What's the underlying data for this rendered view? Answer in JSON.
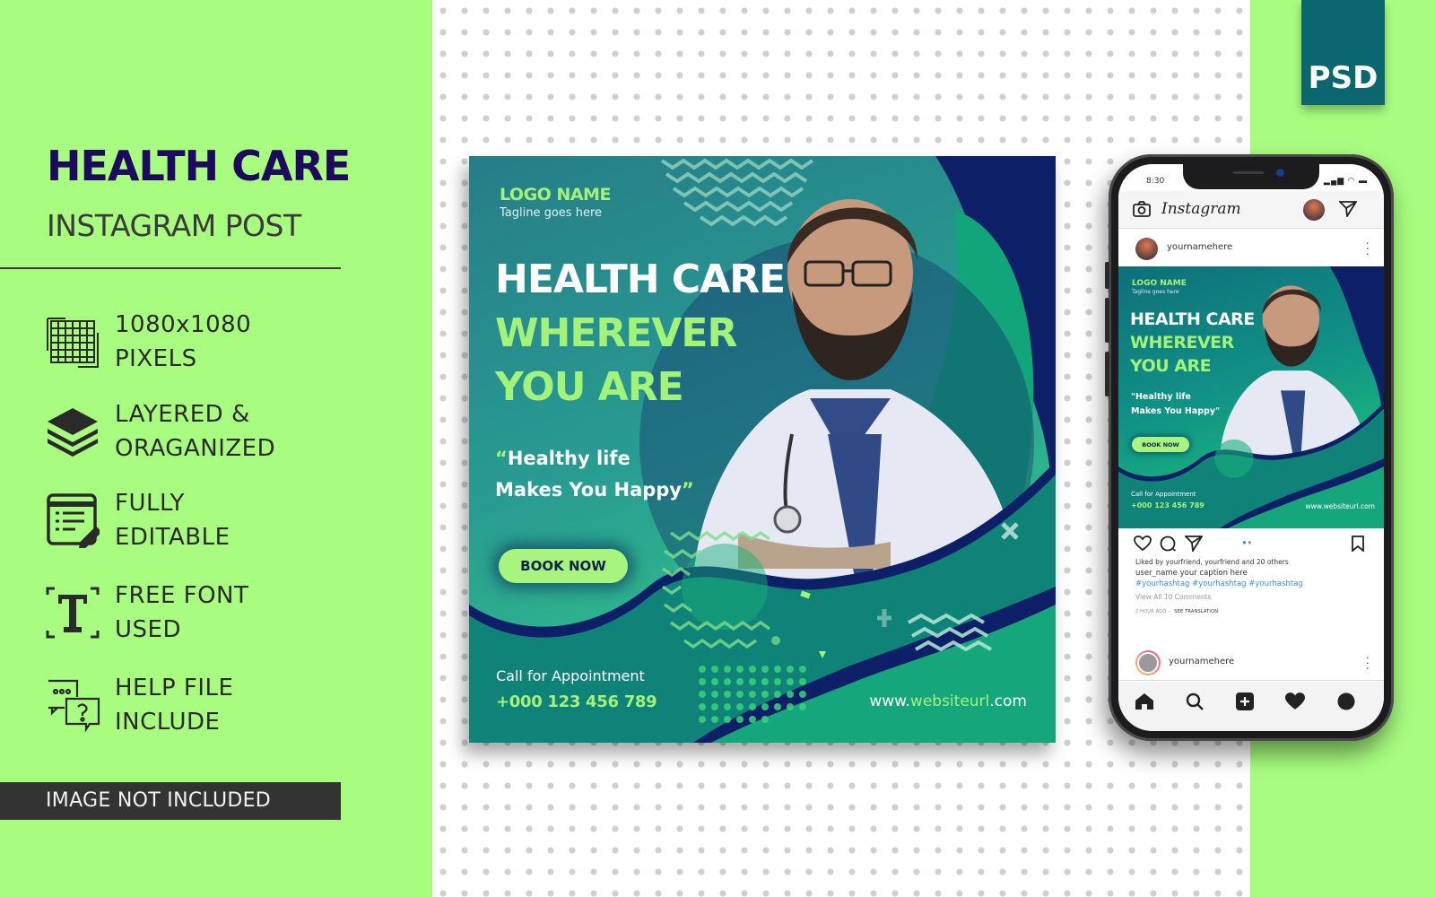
{
  "left_panel": {
    "title": "HEALTH CARE",
    "subtitle": "INSTAGRAM POST",
    "features": [
      {
        "icon": "grid-pixels-icon",
        "line1": "1080x1080",
        "line2": "PIXELS"
      },
      {
        "icon": "layers-icon",
        "line1": "LAYERED &",
        "line2": "ORAGANIZED"
      },
      {
        "icon": "editable-form-icon",
        "line1": "FULLY",
        "line2": "EDITABLE"
      },
      {
        "icon": "text-font-icon",
        "line1": "FREE FONT",
        "line2": "USED"
      },
      {
        "icon": "help-chat-icon",
        "line1": "HELP FILE",
        "line2": "INCLUDE"
      }
    ],
    "note": "IMAGE NOT INCLUDED"
  },
  "badge": {
    "label": "PSD",
    "color": "#0b6670"
  },
  "colors": {
    "background_green": "#a8fd80",
    "title_navy": "#1d0a5e",
    "accent_lime": "#a3f27a",
    "post_teal": "#119186",
    "wave_navy": "#0d1f66"
  },
  "post": {
    "logo": "LOGO NAME",
    "tagline": "Tagline goes here",
    "headline_1": "HEALTH CARE",
    "headline_2": "WHEREVER",
    "headline_3": "YOU ARE",
    "quote_open": "“",
    "quote_line1": "Healthy life",
    "quote_line2": "Makes You Happy",
    "quote_close": "”",
    "cta": "BOOK NOW",
    "call_label": "Call for Appointment",
    "phone": "+000 123 456 789",
    "website_prefix": "www.",
    "website_mid": "websiteurl",
    "website_suffix": ".com"
  },
  "phone_mockup": {
    "status_time": "8:30",
    "status_icons": "▂▄▆ ◠ ▬",
    "app_name": "Instagram",
    "username": "yournamehere",
    "mini_post": {
      "logo": "LOGO NAME",
      "tagline": "Tagline goes here",
      "headline_1": "HEALTH CARE",
      "headline_2": "WHEREVER",
      "headline_3": "YOU ARE",
      "quote_line1": "\"Healthy life",
      "quote_line2": "Makes You Happy\"",
      "cta": "BOOK NOW",
      "call_label": "Call for Appointment",
      "phone": "+000 123 456 789",
      "website": "www.websiteurl.com"
    },
    "carousel": {
      "current": 1,
      "total": 2
    },
    "likes": "Liked by yourfriend, yourfriend and 20 others",
    "caption": "user_name  your caption here",
    "hashtags": "#yourhashtag #yourhashtag #yourhashtag",
    "view_comments": "View All 10 Comments",
    "time_ago": "2 HOUR AGO",
    "see_translation": "SEE TRANSLATION",
    "next_username": "yournamehere"
  }
}
